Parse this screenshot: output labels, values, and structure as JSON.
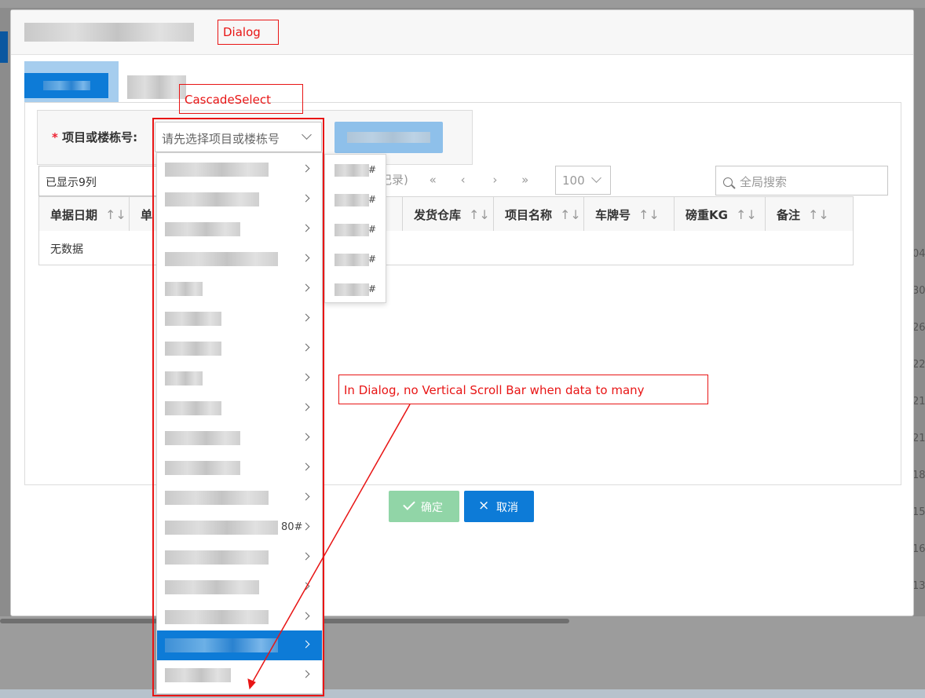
{
  "annotations": {
    "dialog": "Dialog",
    "cascade": "CascadeSelect",
    "note": "In Dialog, no Vertical Scroll Bar when data to many"
  },
  "form": {
    "required_mark": "*",
    "label": "项目或楼栋号:",
    "select_placeholder": "请先选择项目或楼栋号"
  },
  "toolbar": {
    "columns_shown": "已显示9列",
    "pager_tail": "记录)",
    "first": "«",
    "prev": "‹",
    "next": "›",
    "last": "»",
    "page_size": "100",
    "search_placeholder": "全局搜索"
  },
  "grid": {
    "columns": [
      "单据日期",
      "单",
      "发货仓库",
      "项目名称",
      "车牌号",
      "磅重KG",
      "备注"
    ],
    "sort_glyph": "↑↓",
    "empty_text": "无数据"
  },
  "footer": {
    "ok_label": "确定",
    "cancel_label": "取消",
    "cancel_icon": "×"
  },
  "cascade": {
    "item_extra": "80#",
    "selected_index": 16,
    "sub_items": [
      "#",
      "#",
      "#",
      "#",
      "#"
    ]
  },
  "background": {
    "row_numbers": [
      "04",
      "30",
      "26",
      "22",
      "21",
      "21",
      "18",
      "15",
      "16",
      "13"
    ]
  },
  "colors": {
    "primary": "#0d7bd7",
    "success_disabled": "#91d5a7",
    "annotation_red": "#e81515"
  }
}
